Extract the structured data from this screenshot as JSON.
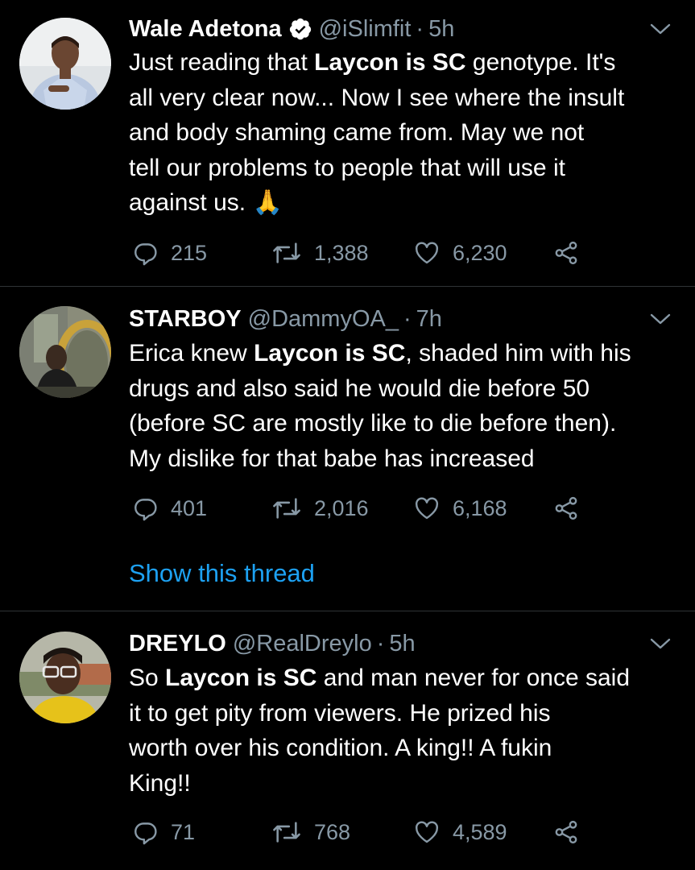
{
  "tweets": [
    {
      "name": "Wale Adetona",
      "verified": true,
      "handle": "@iSlimfit",
      "separator": "·",
      "time": "5h",
      "lines": [
        [
          "Just reading that ",
          "Laycon is SC",
          " genotype. It's"
        ],
        [
          "all very clear now... Now I see where the insult",
          "",
          ""
        ],
        [
          "and body shaming came from. May we not",
          "",
          ""
        ],
        [
          "tell our problems to people that will use it",
          "",
          ""
        ],
        [
          "against us. ",
          "",
          ""
        ]
      ],
      "emoji": "🙏",
      "replies": "215",
      "retweets": "1,388",
      "likes": "6,230"
    },
    {
      "name": "STARBOY",
      "verified": false,
      "handle": "@DammyOA_",
      "separator": "·",
      "time": "7h",
      "lines": [
        [
          "Erica knew ",
          "Laycon is SC",
          ", shaded him with his"
        ],
        [
          "drugs and also said he would die before 50",
          "",
          ""
        ],
        [
          "(before SC are mostly like to die before then).",
          "",
          ""
        ],
        [
          "My dislike for that babe has increased",
          "",
          ""
        ]
      ],
      "replies": "401",
      "retweets": "2,016",
      "likes": "6,168",
      "show_thread": "Show this thread"
    },
    {
      "name": "DREYLO",
      "verified": false,
      "handle": "@RealDreylo",
      "separator": "·",
      "time": "5h",
      "lines": [
        [
          "So ",
          "Laycon is SC",
          " and man never for once said"
        ],
        [
          "it to get pity from viewers. He prized his",
          "",
          ""
        ],
        [
          "worth over his condition. A king!! A fukin",
          "",
          ""
        ],
        [
          "King!!",
          "",
          ""
        ]
      ],
      "replies": "71",
      "retweets": "768",
      "likes": "4,589"
    }
  ],
  "icons": {
    "reply": "reply-icon",
    "retweet": "retweet-icon",
    "like": "heart-icon",
    "share": "share-icon",
    "more": "chevron-down-icon",
    "verified": "verified-badge-icon"
  },
  "colors": {
    "background": "#000000",
    "text": "#ffffff",
    "secondary": "#8899a6",
    "link": "#1da1f2",
    "verified": "#ffffff",
    "divider": "#2f3336"
  }
}
